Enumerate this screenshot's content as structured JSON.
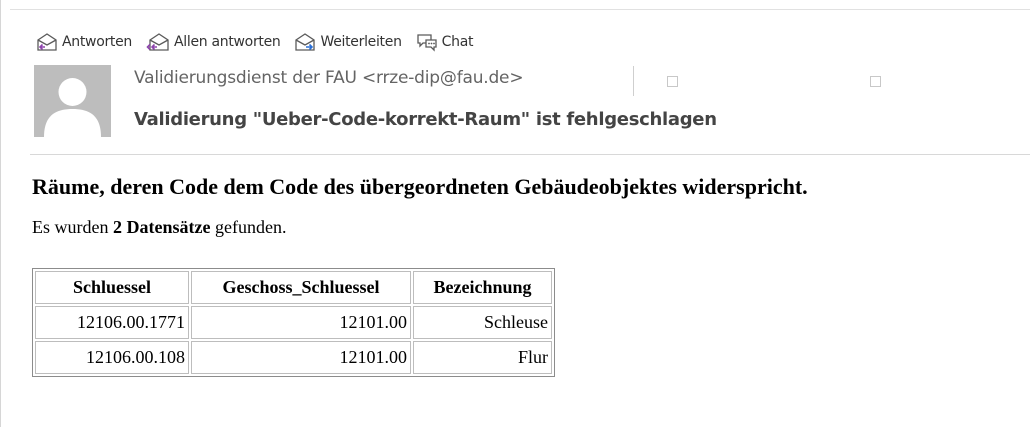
{
  "toolbar": {
    "reply_label": "Antworten",
    "reply_all_label": "Allen antworten",
    "forward_label": "Weiterleiten",
    "chat_label": "Chat"
  },
  "header": {
    "sender": "Validierungsdienst der FAU <rrze-dip@fau.de>",
    "subject": "Validierung \"Ueber-Code-korrekt-Raum\" ist fehlgeschlagen"
  },
  "message": {
    "heading": "Räume, deren Code dem Code des übergeordneten Gebäudeobjektes widerspricht.",
    "summary_prefix": "Es wurden ",
    "summary_bold": "2 Datensätze",
    "summary_suffix": " gefunden.",
    "table": {
      "headers": [
        "Schluessel",
        "Geschoss_Schluessel",
        "Bezeichnung"
      ],
      "rows": [
        [
          "12106.00.1771",
          "12101.00",
          "Schleuse"
        ],
        [
          "12106.00.108",
          "12101.00",
          "Flur"
        ]
      ]
    }
  },
  "colors": {
    "icon_outline": "#5a5a5a",
    "icon_accent_purple": "#8e44ad",
    "icon_accent_blue": "#2a6fd6",
    "avatar_bg": "#bdbdbd"
  }
}
